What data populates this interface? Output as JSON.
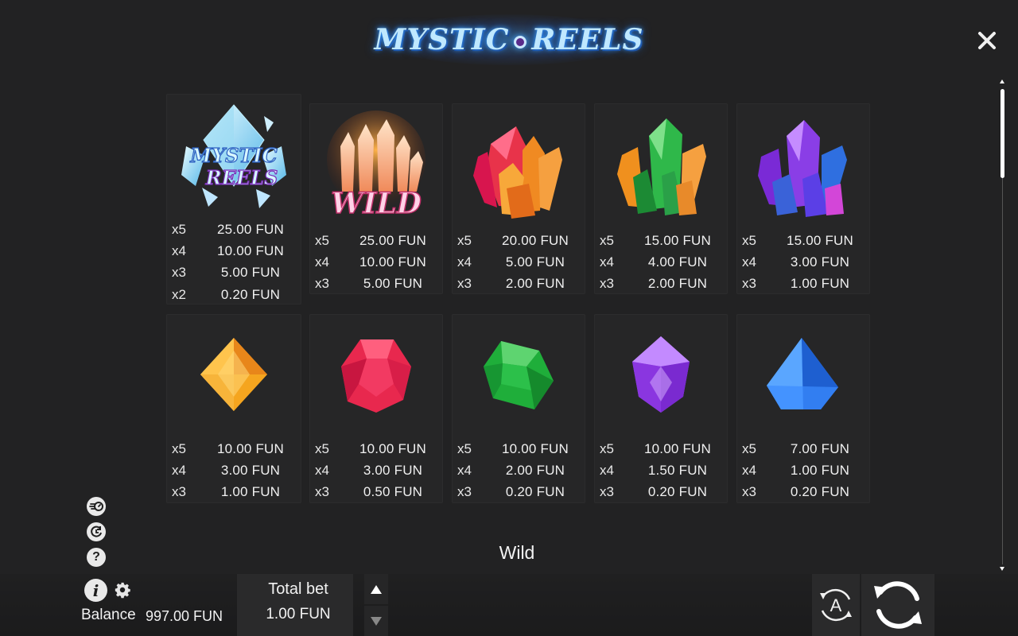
{
  "header": {
    "logo_text_left": "MYSTIC",
    "logo_text_right": "REELS",
    "close_icon": "close-icon"
  },
  "paytable": {
    "row1": [
      {
        "symbol": "mystic-reels-scatter",
        "logo_text": "MYSTIC REELS",
        "color": "#8fd8f5",
        "payouts": [
          {
            "mult": "x5",
            "amount": "25.00 FUN"
          },
          {
            "mult": "x4",
            "amount": "10.00 FUN"
          },
          {
            "mult": "x3",
            "amount": "5.00 FUN"
          },
          {
            "mult": "x2",
            "amount": "0.20 FUN"
          }
        ]
      },
      {
        "symbol": "wild-crystal",
        "logo_text": "WILD",
        "color": "#f29a3a",
        "payouts": [
          {
            "mult": "x5",
            "amount": "25.00 FUN"
          },
          {
            "mult": "x4",
            "amount": "10.00 FUN"
          },
          {
            "mult": "x3",
            "amount": "5.00 FUN"
          }
        ]
      },
      {
        "symbol": "red-orange-crystal-cluster",
        "color": "#e8334a",
        "payouts": [
          {
            "mult": "x5",
            "amount": "20.00 FUN"
          },
          {
            "mult": "x4",
            "amount": "5.00 FUN"
          },
          {
            "mult": "x3",
            "amount": "2.00 FUN"
          }
        ]
      },
      {
        "symbol": "green-orange-crystal-cluster",
        "color": "#2fb84a",
        "payouts": [
          {
            "mult": "x5",
            "amount": "15.00 FUN"
          },
          {
            "mult": "x4",
            "amount": "4.00 FUN"
          },
          {
            "mult": "x3",
            "amount": "2.00 FUN"
          }
        ]
      },
      {
        "symbol": "purple-blue-crystal-cluster",
        "color": "#8a3ee6",
        "payouts": [
          {
            "mult": "x5",
            "amount": "15.00 FUN"
          },
          {
            "mult": "x4",
            "amount": "3.00 FUN"
          },
          {
            "mult": "x3",
            "amount": "1.00 FUN"
          }
        ]
      }
    ],
    "row2": [
      {
        "symbol": "orange-gem",
        "color": "#f5a51f",
        "payouts": [
          {
            "mult": "x5",
            "amount": "10.00 FUN"
          },
          {
            "mult": "x4",
            "amount": "3.00 FUN"
          },
          {
            "mult": "x3",
            "amount": "1.00 FUN"
          }
        ]
      },
      {
        "symbol": "red-gem",
        "color": "#e8284e",
        "payouts": [
          {
            "mult": "x5",
            "amount": "10.00 FUN"
          },
          {
            "mult": "x4",
            "amount": "3.00 FUN"
          },
          {
            "mult": "x3",
            "amount": "0.50 FUN"
          }
        ]
      },
      {
        "symbol": "green-gem",
        "color": "#1fae3a",
        "payouts": [
          {
            "mult": "x5",
            "amount": "10.00 FUN"
          },
          {
            "mult": "x4",
            "amount": "2.00 FUN"
          },
          {
            "mult": "x3",
            "amount": "0.20 FUN"
          }
        ]
      },
      {
        "symbol": "purple-gem",
        "color": "#9b46ef",
        "payouts": [
          {
            "mult": "x5",
            "amount": "10.00 FUN"
          },
          {
            "mult": "x4",
            "amount": "1.50 FUN"
          },
          {
            "mult": "x3",
            "amount": "0.20 FUN"
          }
        ]
      },
      {
        "symbol": "blue-gem",
        "color": "#2f7ff0",
        "payouts": [
          {
            "mult": "x5",
            "amount": "7.00 FUN"
          },
          {
            "mult": "x4",
            "amount": "1.00 FUN"
          },
          {
            "mult": "x3",
            "amount": "0.20 FUN"
          }
        ]
      }
    ]
  },
  "section": {
    "heading": "Wild"
  },
  "side_icons": [
    "turbo-icon",
    "history-icon",
    "help-icon"
  ],
  "side_icon_help_text": "?",
  "bottom": {
    "info_text": "i",
    "balance_label": "Balance",
    "balance_value": "997.00 FUN",
    "total_bet_label": "Total bet",
    "total_bet_value": "1.00 FUN",
    "auto_label": "A"
  }
}
